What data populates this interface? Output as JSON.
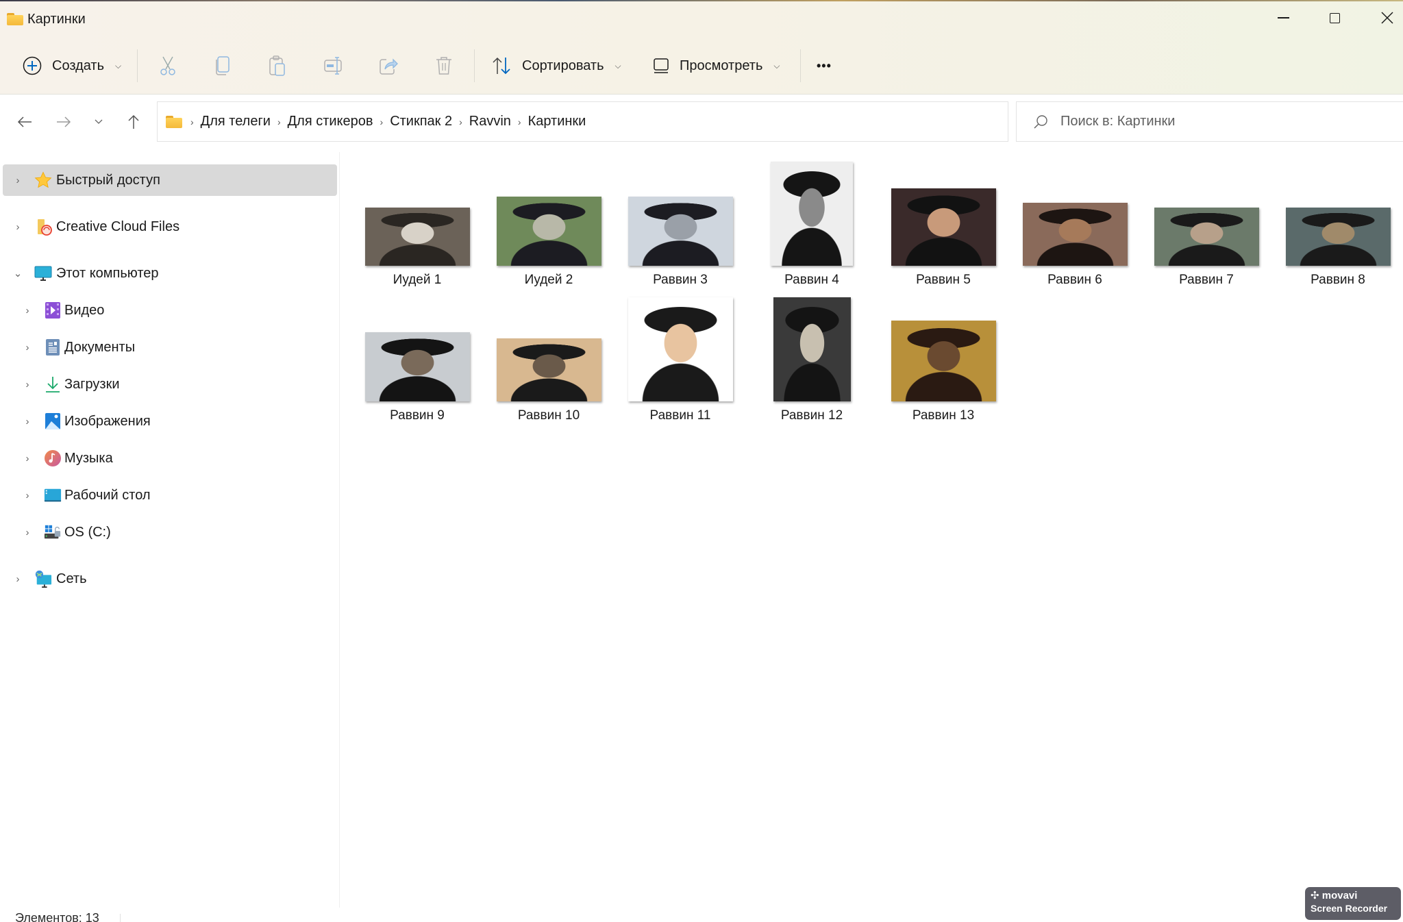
{
  "window": {
    "title": "Картинки",
    "controls": {
      "minimize": "minimize",
      "maximize": "maximize",
      "close": "close"
    }
  },
  "toolbar": {
    "create_label": "Создать",
    "sort_label": "Сортировать",
    "view_label": "Просмотреть",
    "more_label": "•••",
    "icons": [
      "cut-icon",
      "copy-icon",
      "paste-icon",
      "rename-icon",
      "share-icon",
      "delete-icon"
    ]
  },
  "address_bar": {
    "crumbs": [
      "Для телеги",
      "Для стикеров",
      "Стикпак 2",
      "Ravvin",
      "Картинки"
    ]
  },
  "search": {
    "placeholder": "Поиск в: Картинки",
    "value": ""
  },
  "sidebar": {
    "items": [
      {
        "label": "Быстрый доступ",
        "icon": "star-icon",
        "expanded": false,
        "selected": true,
        "level": 0
      },
      {
        "label": "Creative Cloud Files",
        "icon": "creative-cloud-folder-icon",
        "expanded": false,
        "selected": false,
        "level": 0
      },
      {
        "label": "Этот компьютер",
        "icon": "computer-icon",
        "expanded": true,
        "selected": false,
        "level": 0
      },
      {
        "label": "Видео",
        "icon": "video-icon",
        "expanded": false,
        "selected": false,
        "level": 1
      },
      {
        "label": "Документы",
        "icon": "documents-icon",
        "expanded": false,
        "selected": false,
        "level": 1
      },
      {
        "label": "Загрузки",
        "icon": "downloads-icon",
        "expanded": false,
        "selected": false,
        "level": 1
      },
      {
        "label": "Изображения",
        "icon": "pictures-icon",
        "expanded": false,
        "selected": false,
        "level": 1
      },
      {
        "label": "Музыка",
        "icon": "music-icon",
        "expanded": false,
        "selected": false,
        "level": 1
      },
      {
        "label": "Рабочий стол",
        "icon": "desktop-icon",
        "expanded": false,
        "selected": false,
        "level": 1
      },
      {
        "label": "OS (C:)",
        "icon": "drive-icon",
        "expanded": false,
        "selected": false,
        "level": 1
      },
      {
        "label": "Сеть",
        "icon": "network-icon",
        "expanded": false,
        "selected": false,
        "level": 0
      }
    ]
  },
  "files": [
    {
      "name": "Иудей 1",
      "orientation": "landscape"
    },
    {
      "name": "Иудей 2",
      "orientation": "landscape"
    },
    {
      "name": "Раввин 3",
      "orientation": "landscape"
    },
    {
      "name": "Раввин 4",
      "orientation": "portrait"
    },
    {
      "name": "Раввин 5",
      "orientation": "landscape"
    },
    {
      "name": "Раввин 6",
      "orientation": "landscape"
    },
    {
      "name": "Раввин 7",
      "orientation": "landscape"
    },
    {
      "name": "Раввин 8",
      "orientation": "landscape"
    },
    {
      "name": "Раввин 9",
      "orientation": "landscape"
    },
    {
      "name": "Раввин 10",
      "orientation": "landscape"
    },
    {
      "name": "Раввин 11",
      "orientation": "portrait"
    },
    {
      "name": "Раввин 12",
      "orientation": "portrait"
    },
    {
      "name": "Раввин 13",
      "orientation": "landscape"
    }
  ],
  "status_bar": {
    "item_count": "Элементов: 13"
  },
  "watermark": {
    "brand": "movavi",
    "product": "Screen Recorder"
  },
  "colors": {
    "accent": "#0067c0",
    "selection": "#d9d9d9",
    "chrome": "#f6f2e6"
  }
}
